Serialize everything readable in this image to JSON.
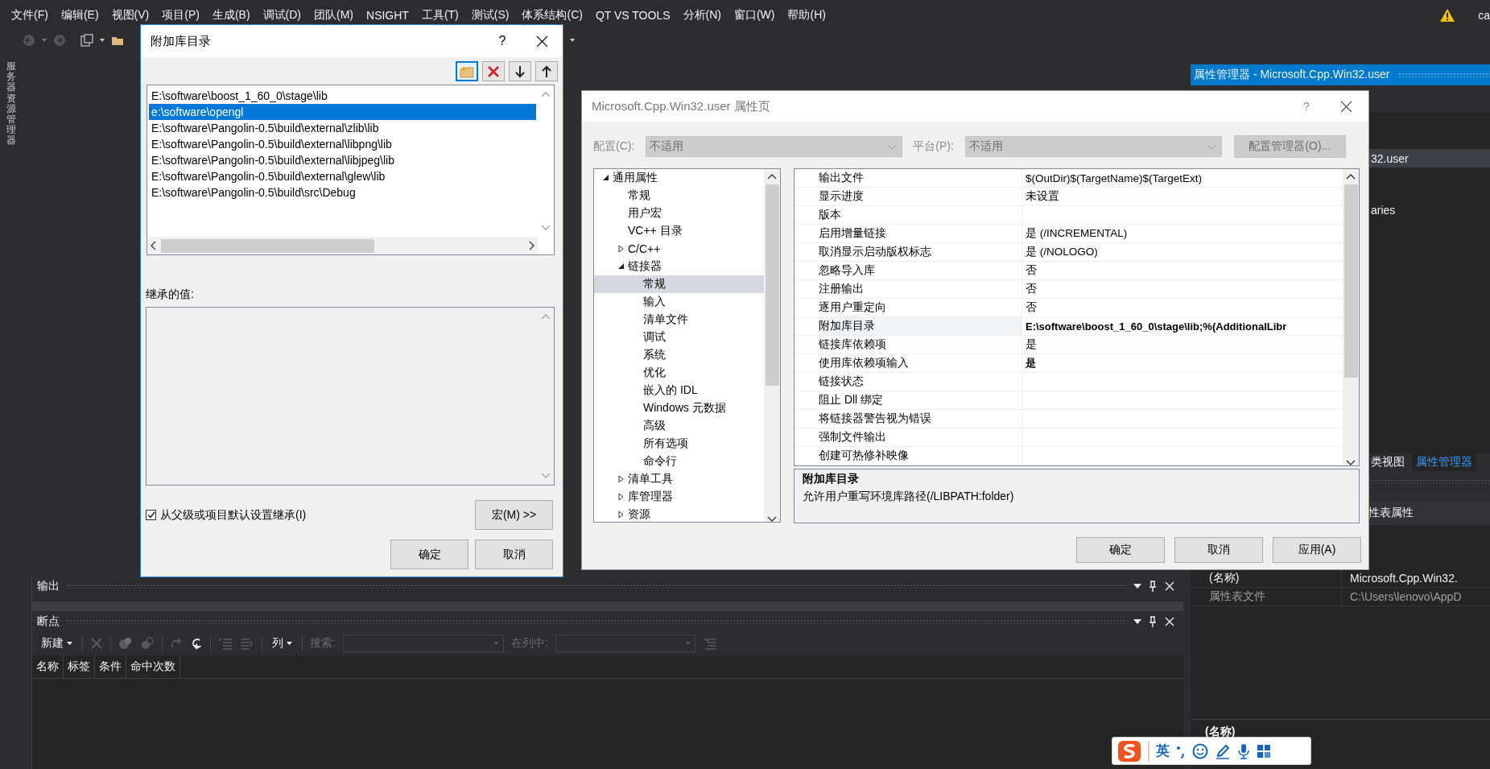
{
  "menu_bar": {
    "items": [
      "文件(F)",
      "编辑(E)",
      "视图(V)",
      "项目(P)",
      "生成(B)",
      "调试(D)",
      "团队(M)",
      "NSIGHT",
      "工具(T)",
      "测试(S)",
      "体系结构(C)",
      "QT VS TOOLS",
      "分析(N)",
      "窗口(W)",
      "帮助(H)"
    ],
    "account": "ca"
  },
  "server_explorer_tab": "服务器资源管理器",
  "output_panel": {
    "title": "输出"
  },
  "breakpoints_panel": {
    "title": "断点",
    "new_button": "新建",
    "columns_button": "列",
    "search_label": "搜索:",
    "in_column_label": "在列中:",
    "columns": [
      "名称",
      "标签",
      "条件",
      "命中次数"
    ]
  },
  "property_manager": {
    "title": "属性管理器 - Microsoft.Cpp.Win32.user",
    "tree_items": [
      {
        "label": "32.user",
        "selected": true
      },
      {
        "label": "aries",
        "selected": false
      }
    ],
    "tabs": [
      {
        "label": "类视图",
        "selected": false
      },
      {
        "label": "属性管理器",
        "selected": true
      }
    ],
    "properties_header": "性表属性",
    "properties": [
      {
        "name": "(名称)",
        "value": "Microsoft.Cpp.Win32."
      },
      {
        "name": "属性表文件",
        "value": "C:\\Users\\lenovo\\AppD"
      }
    ],
    "description_title": "(名称)"
  },
  "library_dialog": {
    "title": "附加库目录",
    "help": "?",
    "entries": [
      {
        "text": "E:\\software\\boost_1_60_0\\stage\\lib",
        "selected": false
      },
      {
        "text": "e:\\software\\opengl",
        "selected": true
      },
      {
        "text": "E:\\software\\Pangolin-0.5\\build\\external\\zlib\\lib",
        "selected": false
      },
      {
        "text": "E:\\software\\Pangolin-0.5\\build\\external\\libpng\\lib",
        "selected": false
      },
      {
        "text": "E:\\software\\Pangolin-0.5\\build\\external\\libjpeg\\lib",
        "selected": false
      },
      {
        "text": "E:\\software\\Pangolin-0.5\\build\\external\\glew\\lib",
        "selected": false
      },
      {
        "text": "E:\\software\\Pangolin-0.5\\build\\src\\Debug",
        "selected": false
      }
    ],
    "inherited_label": "继承的值:",
    "inherit_checkbox": {
      "label": "从父级或项目默认设置继承(I)",
      "checked": true
    },
    "macro_button": "宏(M) >>",
    "ok_button": "确定",
    "cancel_button": "取消"
  },
  "property_dialog": {
    "title": "Microsoft.Cpp.Win32.user 属性页",
    "help": "?",
    "config_label": "配置(C):",
    "config_value": "不适用",
    "platform_label": "平台(P):",
    "platform_value": "不适用",
    "config_manager_button": "配置管理器(O)...",
    "tree": [
      {
        "label": "通用属性",
        "kind": "group",
        "expanded": true,
        "selected": false,
        "children": [
          {
            "label": "常规",
            "kind": "leaf",
            "selected": false
          },
          {
            "label": "用户宏",
            "kind": "leaf",
            "selected": false
          },
          {
            "label": "VC++ 目录",
            "kind": "leaf",
            "selected": false
          },
          {
            "label": "C/C++",
            "kind": "group",
            "expanded": false,
            "selected": false
          },
          {
            "label": "链接器",
            "kind": "group",
            "expanded": true,
            "selected": false,
            "children": [
              {
                "label": "常规",
                "kind": "leaf",
                "selected": true
              },
              {
                "label": "输入",
                "kind": "leaf",
                "selected": false
              },
              {
                "label": "清单文件",
                "kind": "leaf",
                "selected": false
              },
              {
                "label": "调试",
                "kind": "leaf",
                "selected": false
              },
              {
                "label": "系统",
                "kind": "leaf",
                "selected": false
              },
              {
                "label": "优化",
                "kind": "leaf",
                "selected": false
              },
              {
                "label": "嵌入的 IDL",
                "kind": "leaf",
                "selected": false
              },
              {
                "label": "Windows 元数据",
                "kind": "leaf",
                "selected": false
              },
              {
                "label": "高级",
                "kind": "leaf",
                "selected": false
              },
              {
                "label": "所有选项",
                "kind": "leaf",
                "selected": false
              },
              {
                "label": "命令行",
                "kind": "leaf",
                "selected": false
              }
            ]
          },
          {
            "label": "清单工具",
            "kind": "group",
            "expanded": false,
            "selected": false
          },
          {
            "label": "库管理器",
            "kind": "group",
            "expanded": false,
            "selected": false
          },
          {
            "label": "资源",
            "kind": "group",
            "expanded": false,
            "selected": false
          }
        ]
      }
    ],
    "properties": [
      {
        "name": "输出文件",
        "value": "$(OutDir)$(TargetName)$(TargetExt)",
        "bold": false,
        "selected": false
      },
      {
        "name": "显示进度",
        "value": "未设置",
        "bold": false,
        "selected": false
      },
      {
        "name": "版本",
        "selected": false
      },
      {
        "name": "启用增量链接",
        "value": "是 (/INCREMENTAL)",
        "bold": false,
        "selected": false
      },
      {
        "name": "取消显示启动版权标志",
        "value": "是 (/NOLOGO)",
        "bold": false,
        "selected": false
      },
      {
        "name": "忽略导入库",
        "value": "否",
        "bold": false,
        "selected": false
      },
      {
        "name": "注册输出",
        "value": "否",
        "bold": false,
        "selected": false
      },
      {
        "name": "逐用户重定向",
        "value": "否",
        "bold": false,
        "selected": false
      },
      {
        "name": "附加库目录",
        "value": "E:\\software\\boost_1_60_0\\stage\\lib;%(AdditionalLibr",
        "bold": true,
        "selected": true
      },
      {
        "name": "链接库依赖项",
        "value": "是",
        "bold": false,
        "selected": false
      },
      {
        "name": "使用库依赖项输入",
        "value": "是",
        "bold": true,
        "selected": false
      },
      {
        "name": "链接状态",
        "selected": false
      },
      {
        "name": "阻止 Dll 绑定",
        "selected": false
      },
      {
        "name": "将链接器警告视为错误",
        "selected": false
      },
      {
        "name": "强制文件输出",
        "selected": false
      },
      {
        "name": "创建可热修补映像",
        "selected": false
      }
    ],
    "description_title": "附加库目录",
    "description_text": "允许用户重写环境库路径(/LIBPATH:folder)",
    "ok_button": "确定",
    "cancel_button": "取消",
    "apply_button": "应用(A)"
  },
  "ime_bar": {
    "mode": "英"
  }
}
